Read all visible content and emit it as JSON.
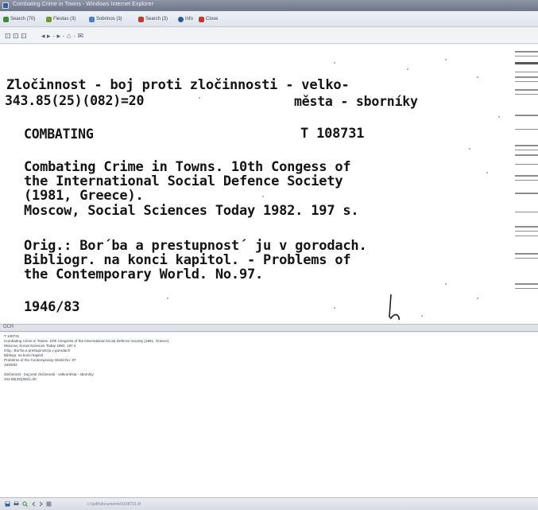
{
  "window": {
    "title": "Combating Crime in Towns - Windows Internet Explorer"
  },
  "favorites": [
    {
      "label": "Search (70)",
      "color": "#3c8a3a"
    },
    {
      "label": "Fiestas (3)",
      "color": "#6b9a2e"
    },
    {
      "label": "Sobrinos (3)",
      "color": "#4f7ec2"
    },
    {
      "label": "Search (3)",
      "color": "#c0392b"
    },
    {
      "label": "Info",
      "color": "#2457a6"
    },
    {
      "label": "Close",
      "color": "#c0392b"
    }
  ],
  "toolbar": {
    "nav_glyphs": "⊡ ⊡ ⊡",
    "arrows": "◂ ▸ · ▸ · ⌂ · ✉"
  },
  "card": {
    "heading_line1": "Zločinnost - boj proti zločinnosti - velko-",
    "heading_line2_left": "343.85(25)(082)=20",
    "heading_line2_right": "města - sborníky",
    "code_left": "COMBATING",
    "code_right": "T 108731",
    "body": [
      "Combating Crime in Towns. 10th Congess of",
      "the International Social Defence Society",
      "(1981, Greece).",
      "Moscow, Social Sciences Today 1982. 197 s."
    ],
    "notes": [
      "Orig.: Bor´ba a prestupnost´ ju v gorodach.",
      "Bibliogr. na konci kapitol. - Problems of",
      "the Contemporary World. No.97."
    ],
    "number": "1946/83"
  },
  "splitter": {
    "label": "OCR"
  },
  "ocr_text": [
    "T 108731",
    "Combating Crime in Towns. 10th Congress of the International Social Defence Society (1981, Greece)",
    "Moscow, Social Sciences Today 1982. 197 s.",
    "Orig.: Bor'ba a prestupnost'ju v gorodach",
    "Bibliogr. na konci kapitol",
    "Problems of the Contemporary World No. 97",
    "1946/83",
    "",
    "Zločinnost - boj proti zločinnosti - velkoměsta - sborníky",
    "343.85(25)(082)=20"
  ],
  "status": {
    "icons": [
      "save-icon",
      "print-icon",
      "zoom-icon",
      "prev-icon",
      "next-icon",
      "settings-icon"
    ],
    "text": "c:\\\\pdf\\\\documents\\\\t108731.tif"
  },
  "colors": {
    "accent": "#2f5ea8",
    "titlebar": "#7a8394"
  }
}
